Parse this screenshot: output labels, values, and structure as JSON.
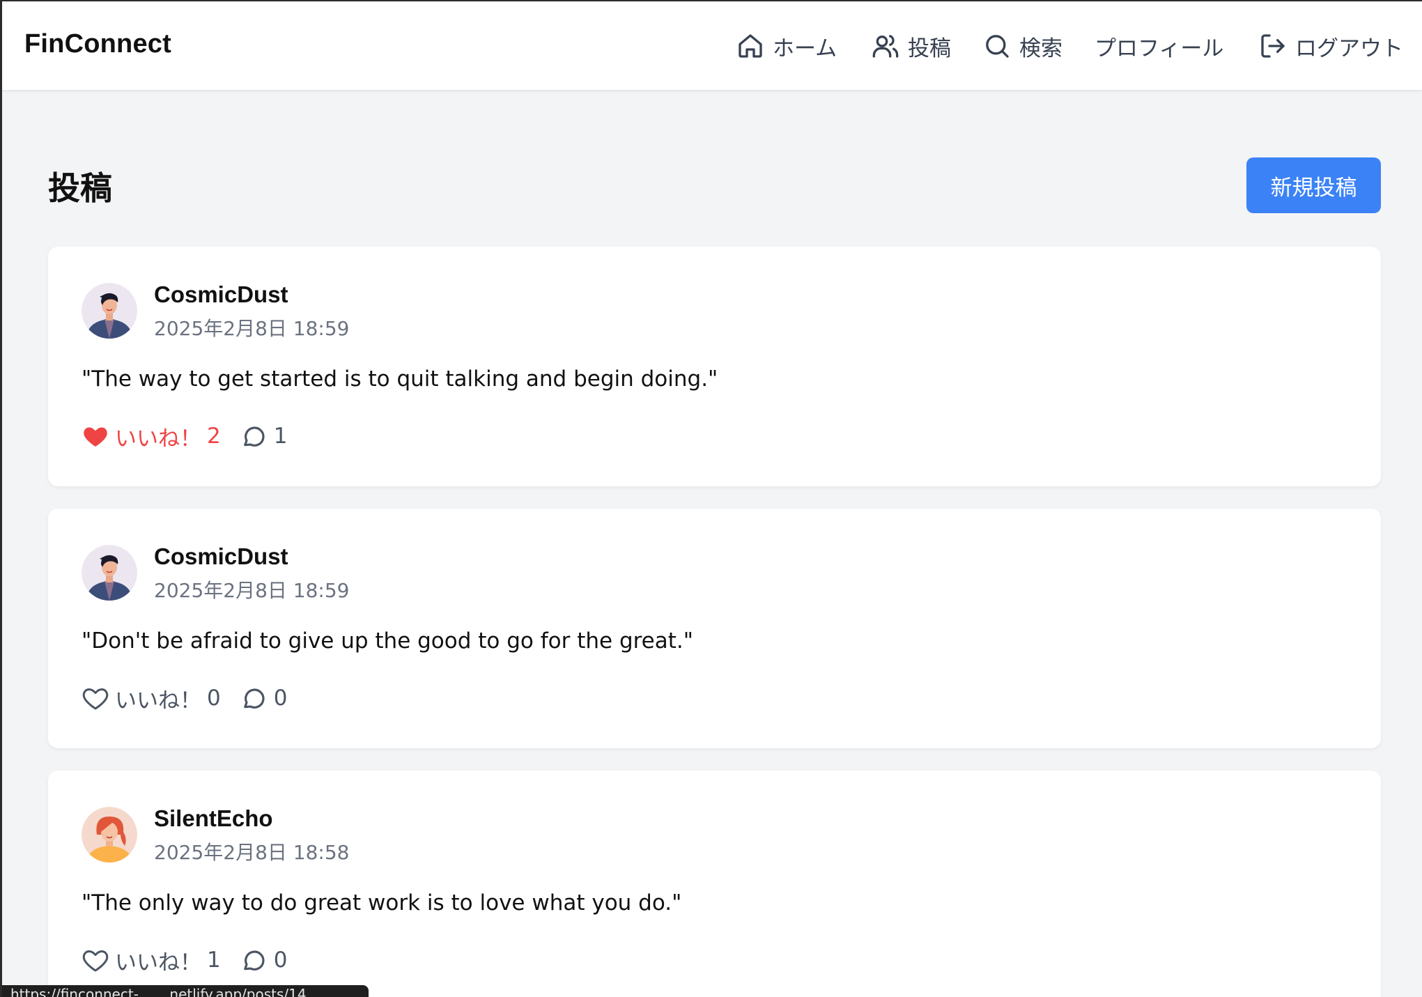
{
  "header": {
    "brand": "FinConnect",
    "nav": {
      "home": "ホーム",
      "posts": "投稿",
      "search": "検索",
      "profile": "プロフィール",
      "logout": "ログアウト"
    }
  },
  "main": {
    "title": "投稿",
    "new_post_label": "新規投稿"
  },
  "posts": [
    {
      "username": "CosmicDust",
      "timestamp": "2025年2月8日 18:59",
      "content": "\"The way to get started is to quit talking and begin doing.\"",
      "like_label": "いいね！",
      "like_count": "2",
      "liked": true,
      "comment_count": "1",
      "avatar_icon": "male-avatar-icon"
    },
    {
      "username": "CosmicDust",
      "timestamp": "2025年2月8日 18:59",
      "content": "\"Don't be afraid to give up the good to go for the great.\"",
      "like_label": "いいね！",
      "like_count": "0",
      "liked": false,
      "comment_count": "0",
      "avatar_icon": "male-avatar-icon"
    },
    {
      "username": "SilentEcho",
      "timestamp": "2025年2月8日 18:58",
      "content": "\"The only way to do great work is to love what you do.\"",
      "like_label": "いいね！",
      "like_count": "1",
      "liked": false,
      "comment_count": "0",
      "avatar_icon": "female-avatar-icon"
    }
  ],
  "status_bar": {
    "url": "https://finconnect-.......netlify.app/posts/14"
  },
  "colors": {
    "accent": "#3b82f6",
    "liked": "#ef4444",
    "background": "#f3f4f6"
  }
}
